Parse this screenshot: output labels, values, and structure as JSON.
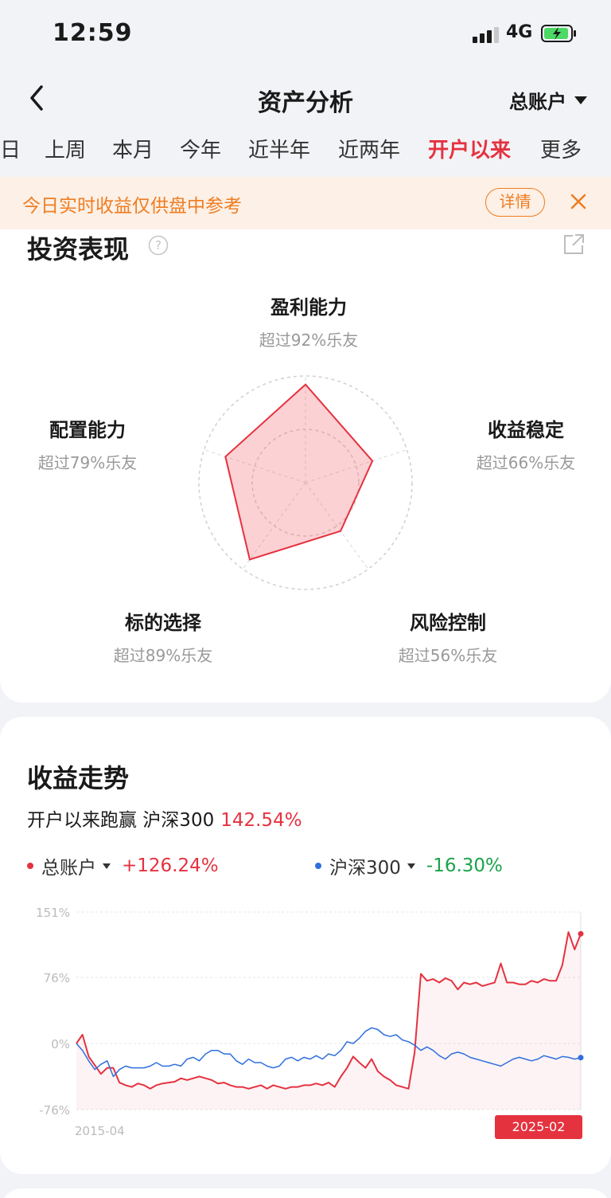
{
  "status_bar": {
    "time": "12:59",
    "network": "4G"
  },
  "nav": {
    "title": "资产分析",
    "account": "总账户"
  },
  "period_tabs": [
    {
      "label": "日"
    },
    {
      "label": "上周"
    },
    {
      "label": "本月"
    },
    {
      "label": "今年"
    },
    {
      "label": "近半年"
    },
    {
      "label": "近两年"
    },
    {
      "label": "开户以来",
      "active": true
    },
    {
      "label": "更多"
    }
  ],
  "notice": {
    "text": "今日实时收益仅供盘中参考",
    "detail_label": "详情"
  },
  "performance": {
    "title": "投资表现",
    "metrics": [
      {
        "name": "盈利能力",
        "desc": "超过92%乐友",
        "score": 92
      },
      {
        "name": "收益稳定",
        "desc": "超过66%乐友",
        "score": 66
      },
      {
        "name": "风险控制",
        "desc": "超过56%乐友",
        "score": 56
      },
      {
        "name": "标的选择",
        "desc": "超过89%乐友",
        "score": 89
      },
      {
        "name": "配置能力",
        "desc": "超过79%乐友",
        "score": 79
      }
    ],
    "accent_color": "#e5323f"
  },
  "trend": {
    "title": "收益走势",
    "beat_text": "开户以来跑赢 沪深300",
    "beat_value": "142.54%",
    "legend": [
      {
        "name": "总账户",
        "value": "+126.24%",
        "color": "#e5323f"
      },
      {
        "name": "沪深300",
        "value": "-16.30%",
        "color": "#2f6fde",
        "value_color": "#1aa34a"
      }
    ],
    "start_date": "2015-04",
    "end_date": "2025-02"
  },
  "chart_data": {
    "type": "line",
    "y_ticks": [
      "151%",
      "76%",
      "0%",
      "-76%"
    ],
    "ylim": [
      -76,
      151
    ],
    "x_labels": [
      "2015-04",
      "2025-02"
    ],
    "series": [
      {
        "name": "总账户",
        "color": "#e5323f",
        "values": [
          0,
          10,
          -15,
          -25,
          -35,
          -28,
          -28,
          -45,
          -48,
          -50,
          -46,
          -48,
          -52,
          -48,
          -46,
          -45,
          -44,
          -40,
          -42,
          -40,
          -38,
          -40,
          -42,
          -46,
          -45,
          -48,
          -50,
          -50,
          -52,
          -50,
          -48,
          -52,
          -48,
          -50,
          -52,
          -50,
          -50,
          -48,
          -48,
          -46,
          -48,
          -45,
          -50,
          -38,
          -28,
          -15,
          -22,
          -28,
          -18,
          -32,
          -38,
          -42,
          -48,
          -50,
          -52,
          -10,
          80,
          72,
          74,
          70,
          75,
          72,
          62,
          70,
          68,
          70,
          66,
          68,
          70,
          92,
          70,
          70,
          68,
          68,
          72,
          70,
          74,
          72,
          72,
          90,
          128,
          108,
          126
        ]
      },
      {
        "name": "沪深300",
        "color": "#2f6fde",
        "values": [
          0,
          -8,
          -20,
          -30,
          -24,
          -20,
          -38,
          -30,
          -26,
          -28,
          -28,
          -28,
          -26,
          -22,
          -26,
          -26,
          -24,
          -26,
          -18,
          -16,
          -20,
          -12,
          -8,
          -8,
          -12,
          -12,
          -20,
          -24,
          -18,
          -22,
          -22,
          -26,
          -28,
          -26,
          -18,
          -16,
          -20,
          -16,
          -18,
          -14,
          -18,
          -12,
          -14,
          -8,
          2,
          0,
          6,
          14,
          18,
          16,
          10,
          8,
          10,
          4,
          2,
          -2,
          -8,
          -4,
          -8,
          -14,
          -18,
          -12,
          -10,
          -12,
          -16,
          -18,
          -20,
          -22,
          -24,
          -26,
          -22,
          -18,
          -16,
          -18,
          -20,
          -18,
          -14,
          -16,
          -18,
          -15,
          -16,
          -18,
          -16.3
        ]
      }
    ]
  }
}
